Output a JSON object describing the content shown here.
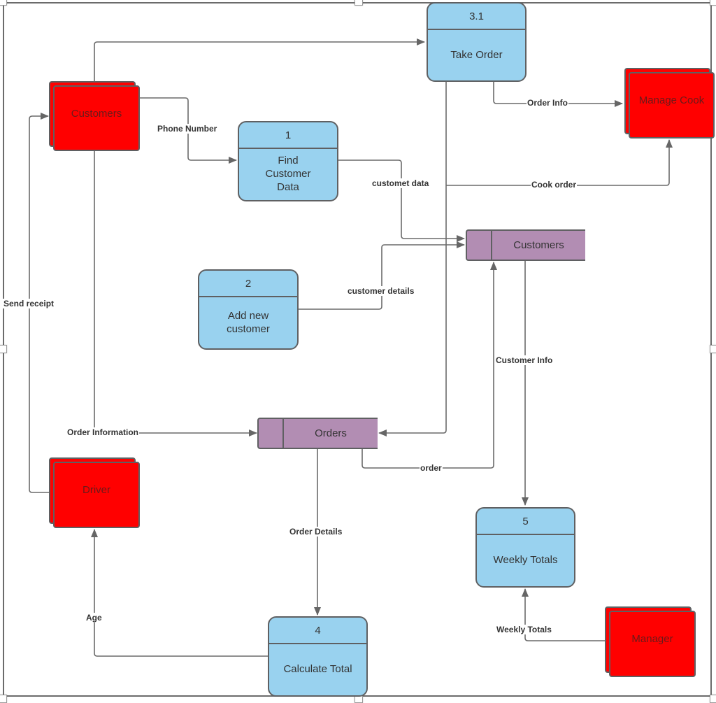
{
  "diagram": {
    "type": "data-flow-diagram",
    "colors": {
      "process_fill": "#99d2ef",
      "entity_fill": "#ff0000",
      "store_fill": "#b28db3",
      "stroke": "#5f6062",
      "line": "#666666"
    },
    "processes": [
      {
        "id": "3.1",
        "name": "Take Order"
      },
      {
        "id": "1",
        "name": "Find Customer Data"
      },
      {
        "id": "2",
        "name": "Add new customer"
      },
      {
        "id": "5",
        "name": "Weekly Totals"
      },
      {
        "id": "4",
        "name": "Calculate Total"
      }
    ],
    "entities": [
      {
        "name": "Customers"
      },
      {
        "name": "Manage Cook"
      },
      {
        "name": "Driver"
      },
      {
        "name": "Manager"
      }
    ],
    "stores": [
      {
        "name": "Customers"
      },
      {
        "name": "Orders"
      }
    ],
    "flows": [
      {
        "label": "",
        "from": "Customers",
        "to": "Take Order"
      },
      {
        "label": "Phone Number",
        "from": "Customers",
        "to": "Find Customer Data"
      },
      {
        "label": "Order Info",
        "from": "Take Order",
        "to": "Manage Cook"
      },
      {
        "label": "customet data",
        "from": "Find Customer Data",
        "to": "Customers store"
      },
      {
        "label": "Cook order",
        "from": "Take Order",
        "to": "Manage Cook"
      },
      {
        "label": "customer details",
        "from": "Add new customer",
        "to": "Customers store"
      },
      {
        "label": "Send receipt",
        "from": "Driver",
        "to": "Customers"
      },
      {
        "label": "Customer Info",
        "from": "Customers store",
        "to": "Weekly Totals"
      },
      {
        "label": "Order Information",
        "from": "Customers",
        "to": "Orders"
      },
      {
        "label": "",
        "from": "Take Order",
        "to": "Orders"
      },
      {
        "label": "order",
        "from": "Orders",
        "to": "Customers store"
      },
      {
        "label": "Order Details",
        "from": "Orders",
        "to": "Calculate Total"
      },
      {
        "label": "Age",
        "from": "Calculate Total",
        "to": "Driver"
      },
      {
        "label": "Weekly Totals",
        "from": "Manager",
        "to": "Weekly Totals"
      }
    ]
  }
}
